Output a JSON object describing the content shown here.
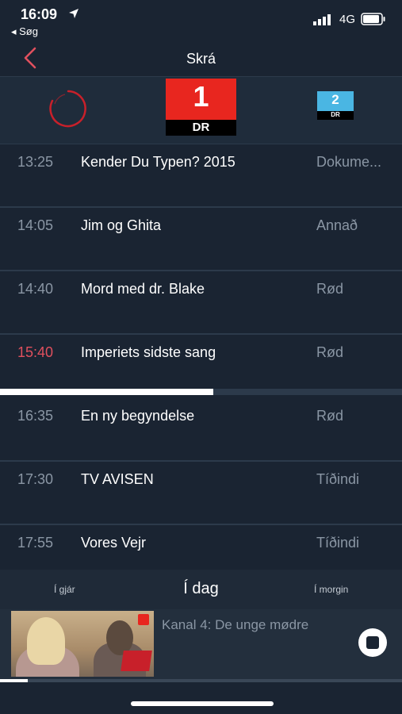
{
  "status_bar": {
    "time": "16:09",
    "back_app": "◂ Søg",
    "network": "4G"
  },
  "nav": {
    "title": "Skrá"
  },
  "channels": [
    {
      "name": "loading",
      "label": ""
    },
    {
      "name": "DR1",
      "number": "1",
      "brand": "DR",
      "color": "#e8261f"
    },
    {
      "name": "DR2",
      "number": "2",
      "brand": "DR",
      "color": "#4ab6e3"
    }
  ],
  "schedule": [
    {
      "time": "13:25",
      "title": "Kender Du Typen? 2015",
      "genre": "Dokume...",
      "live": false
    },
    {
      "time": "14:05",
      "title": "Jim og Ghita",
      "genre": "Annað",
      "live": false
    },
    {
      "time": "14:40",
      "title": "Mord med dr. Blake",
      "genre": "Rød",
      "live": false
    },
    {
      "time": "15:40",
      "title": "Imperiets sidste sang",
      "genre": "Rød",
      "live": true
    },
    {
      "time": "16:35",
      "title": "En ny begyndelse",
      "genre": "Rød",
      "live": false
    },
    {
      "time": "17:30",
      "title": "TV AVISEN",
      "genre": "Tíðindi",
      "live": false
    },
    {
      "time": "17:55",
      "title": "Vores Vejr",
      "genre": "Tíðindi",
      "live": false
    }
  ],
  "live_progress": 0.53,
  "day_nav": {
    "prev": "Í gjár",
    "current": "Í dag",
    "next": "Í morgin"
  },
  "mini_player": {
    "title": "Kanal 4: De unge mødre",
    "progress": 0.07
  },
  "colors": {
    "background": "#1a2432",
    "accent_live": "#e0505e",
    "dr1": "#e8261f",
    "dr2": "#4ab6e3"
  },
  "icons": [
    "location-arrow-icon",
    "signal-icon",
    "battery-icon",
    "back-chevron-icon",
    "loading-ring-icon",
    "stop-icon"
  ]
}
